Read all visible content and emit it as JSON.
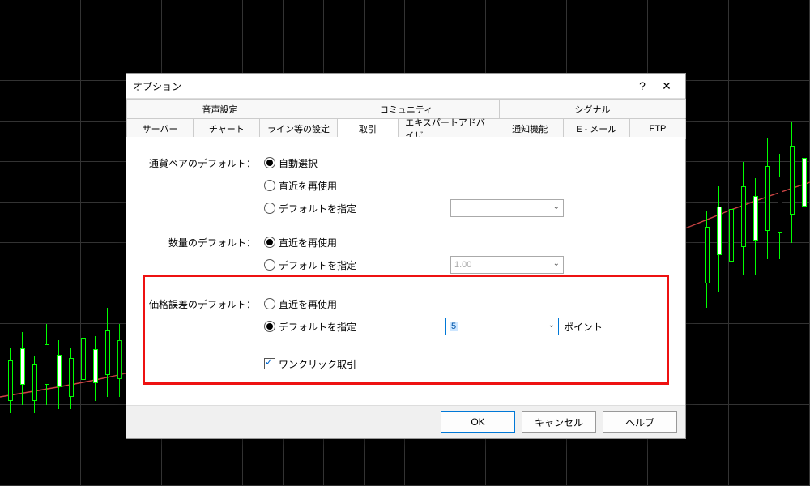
{
  "dialog": {
    "title": "オプション",
    "help_icon": "?",
    "close_icon": "✕",
    "upper_tabs": [
      "音声設定",
      "コミュニティ",
      "シグナル"
    ],
    "lower_tabs": [
      "サーバー",
      "チャート",
      "ライン等の設定",
      "取引",
      "エキスパートアドバイザ",
      "通知機能",
      "E - メール",
      "FTP"
    ],
    "active_lower_tab": "取引",
    "sections": {
      "currency": {
        "label": "通貨ペアのデフォルト：",
        "opt_auto": "自動選択",
        "opt_reuse": "直近を再使用",
        "opt_default": "デフォルトを指定",
        "combo_value": ""
      },
      "volume": {
        "label": "数量のデフォルト：",
        "opt_reuse": "直近を再使用",
        "opt_default": "デフォルトを指定",
        "combo_value": "1.00"
      },
      "deviation": {
        "label": "価格誤差のデフォルト：",
        "opt_reuse": "直近を再使用",
        "opt_default": "デフォルトを指定",
        "combo_value": "5",
        "unit": "ポイント"
      },
      "oneclick": {
        "label": "ワンクリック取引"
      }
    },
    "buttons": {
      "ok": "OK",
      "cancel": "キャンセル",
      "help": "ヘルプ"
    }
  }
}
